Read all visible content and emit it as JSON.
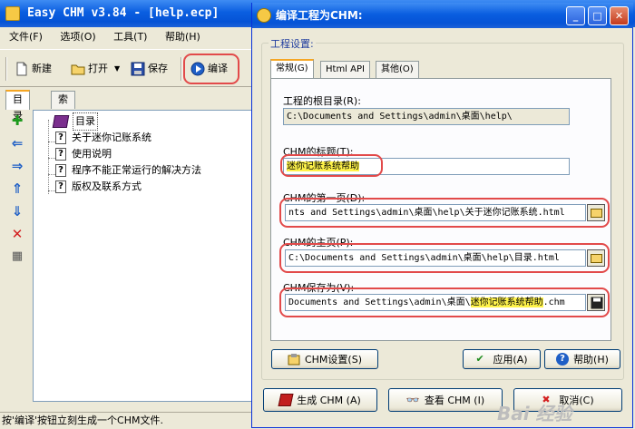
{
  "main_window": {
    "title": "Easy CHM v3.84 - [help.ecp]",
    "menu": [
      "文件(F)",
      "选项(O)",
      "工具(T)",
      "帮助(H)"
    ],
    "toolbar": {
      "new": "新建",
      "open": "打开",
      "save": "保存",
      "compile": "编译"
    },
    "tabs": [
      "目录",
      "索引"
    ],
    "tree": {
      "root": "目录",
      "items": [
        "关于迷你记账系统",
        "使用说明",
        "程序不能正常运行的解决方法",
        "版权及联系方式"
      ]
    },
    "status": "按'编译'按钮立刻生成一个CHM文件."
  },
  "dialog": {
    "title": "编译工程为CHM:",
    "group_label": "工程设置:",
    "tabs": [
      "常规(G)",
      "Html API",
      "其他(O)"
    ],
    "fields": {
      "root_dir": {
        "label": "工程的根目录(R):",
        "value": "C:\\Documents and Settings\\admin\\桌面\\help\\"
      },
      "chm_title": {
        "label": "CHM的标题(T):",
        "value": "迷你记账系统帮助"
      },
      "first_page": {
        "label": "CHM的第一页(D):",
        "value": "nts and Settings\\admin\\桌面\\help\\关于迷你记账系统.html"
      },
      "home_page": {
        "label": "CHM的主页(P):",
        "value": "C:\\Documents and Settings\\admin\\桌面\\help\\目录.html"
      },
      "save_as": {
        "label": "CHM保存为(V):",
        "value_prefix": "Documents and Settings\\admin\\桌面\\",
        "value_highlight": "迷你记账系统帮助",
        "value_suffix": ".chm"
      }
    },
    "buttons": {
      "chm_settings": "CHM设置(S)",
      "apply": "应用(A)",
      "help": "帮助(H)",
      "generate": "生成 CHM (A)",
      "view": "查看 CHM (I)",
      "cancel": "取消(C)"
    }
  },
  "watermark": "Bai 经验",
  "colors": {
    "titlebar": "#0a5ee0",
    "annotation": "#e24a4a",
    "highlight": "#fff34a"
  }
}
